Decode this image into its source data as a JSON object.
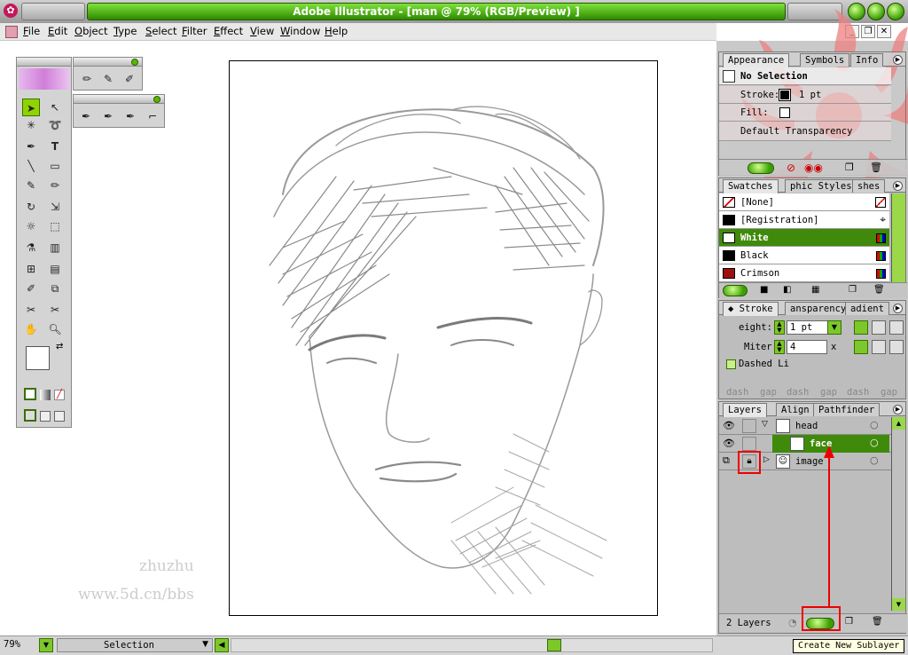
{
  "window": {
    "title": "Adobe Illustrator - [man @ 79% (RGB/Preview) ]"
  },
  "menu": [
    "File",
    "Edit",
    "Object",
    "Type",
    "Select",
    "Filter",
    "Effect",
    "View",
    "Window",
    "Help"
  ],
  "watermark": {
    "line1": "zhuzhu",
    "line2": "www.5d.cn/bbs"
  },
  "appearance_panel": {
    "tabs": [
      "Appearance",
      "Symbols",
      "Info"
    ],
    "selection": "No Selection",
    "stroke_label": "Stroke:",
    "stroke_value": "1 pt",
    "fill_label": "Fill:",
    "transparency": "Default Transparency"
  },
  "swatches_panel": {
    "tabs": [
      "Swatches",
      "phic Styles",
      "shes"
    ],
    "rows": [
      {
        "name": "[None]",
        "color": "#ffffff"
      },
      {
        "name": "[Registration]",
        "color": "#000000"
      },
      {
        "name": "White",
        "color": "#ffffff"
      },
      {
        "name": "Black",
        "color": "#000000"
      },
      {
        "name": "Crimson",
        "color": "#a01010"
      }
    ]
  },
  "stroke_panel": {
    "tabs": [
      "Stroke",
      "ansparency",
      "adient"
    ],
    "weight_label": "eight:",
    "weight_value": "1 pt",
    "miter_label": "Miter",
    "miter_value": "4",
    "miter_unit": "x",
    "dashed_label": "Dashed Li",
    "dash_labels": [
      "dash",
      "gap",
      "dash",
      "gap",
      "dash",
      "gap"
    ]
  },
  "layers_panel": {
    "tabs": [
      "Layers",
      "Align",
      "Pathfinder"
    ],
    "rows": [
      {
        "name": "head"
      },
      {
        "name": "face"
      },
      {
        "name": "image"
      }
    ],
    "count": "2 Layers"
  },
  "tooltip": "Create New Sublayer",
  "status": {
    "zoom": "79%",
    "tool": "Selection"
  },
  "colors": {
    "accent": "#3f8a0a",
    "highlight_red": "#e00000"
  }
}
